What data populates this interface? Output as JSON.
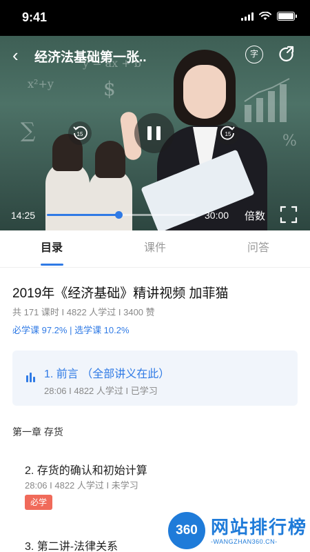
{
  "status_bar": {
    "time": "9:41"
  },
  "player": {
    "title": "经济法基础第一张..",
    "subtitle_icon_char": "字",
    "current_time": "14:25",
    "total_time": "30:00",
    "progress_fraction": 0.48,
    "speed_label": "倍数",
    "skip_back_seconds": "15",
    "skip_forward_seconds": "15",
    "board_scribbles": [
      "x²+y",
      "y = ax + b",
      "∑",
      "$",
      "%"
    ]
  },
  "tabs": [
    {
      "label": "目录",
      "active": true
    },
    {
      "label": "课件",
      "active": false
    },
    {
      "label": "问答",
      "active": false
    }
  ],
  "course": {
    "title": "2019年《经济基础》精讲视频  加菲猫",
    "stats": "共 171 课时 I 4822 人学过 I 3400 赞",
    "ratio": "必学课 97.2% | 选学课 10.2%"
  },
  "current_lesson": {
    "title": "1. 前言  （全部讲义在此）",
    "meta": "28:06 I 4822 人学过 I 已学习"
  },
  "chapter": {
    "title": "第一章 存货"
  },
  "lessons": [
    {
      "title": "2. 存货的确认和初始计算",
      "meta": "28:06 I 4822 人学过 I 未学习",
      "badge": "必学"
    },
    {
      "title": "3. 第二讲-法律关系"
    }
  ],
  "watermark": {
    "logo_text": "360",
    "name": "网站排行榜",
    "sub": "-WANGZHAN360.CN-"
  },
  "colors": {
    "accent": "#2f7ae5",
    "badge": "#f06a5a"
  }
}
